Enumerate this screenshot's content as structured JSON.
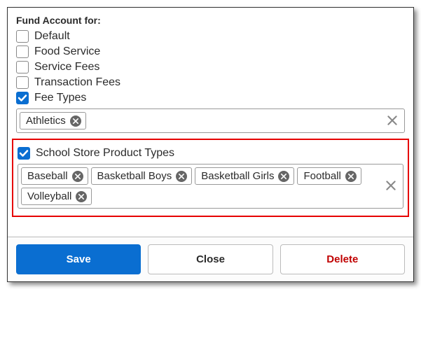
{
  "header": {
    "title": "Fund Account for:"
  },
  "checkboxes": {
    "default": {
      "label": "Default",
      "checked": false
    },
    "food_service": {
      "label": "Food Service",
      "checked": false
    },
    "service_fees": {
      "label": "Service Fees",
      "checked": false
    },
    "transaction_fees": {
      "label": "Transaction Fees",
      "checked": false
    },
    "fee_types": {
      "label": "Fee Types",
      "checked": true
    },
    "store_types": {
      "label": "School Store Product Types",
      "checked": true
    }
  },
  "fee_types_tags": [
    {
      "label": "Athletics"
    }
  ],
  "store_types_tags": [
    {
      "label": "Baseball"
    },
    {
      "label": "Basketball Boys"
    },
    {
      "label": "Basketball Girls"
    },
    {
      "label": "Football"
    },
    {
      "label": "Volleyball"
    }
  ],
  "buttons": {
    "save": "Save",
    "close": "Close",
    "delete": "Delete"
  }
}
